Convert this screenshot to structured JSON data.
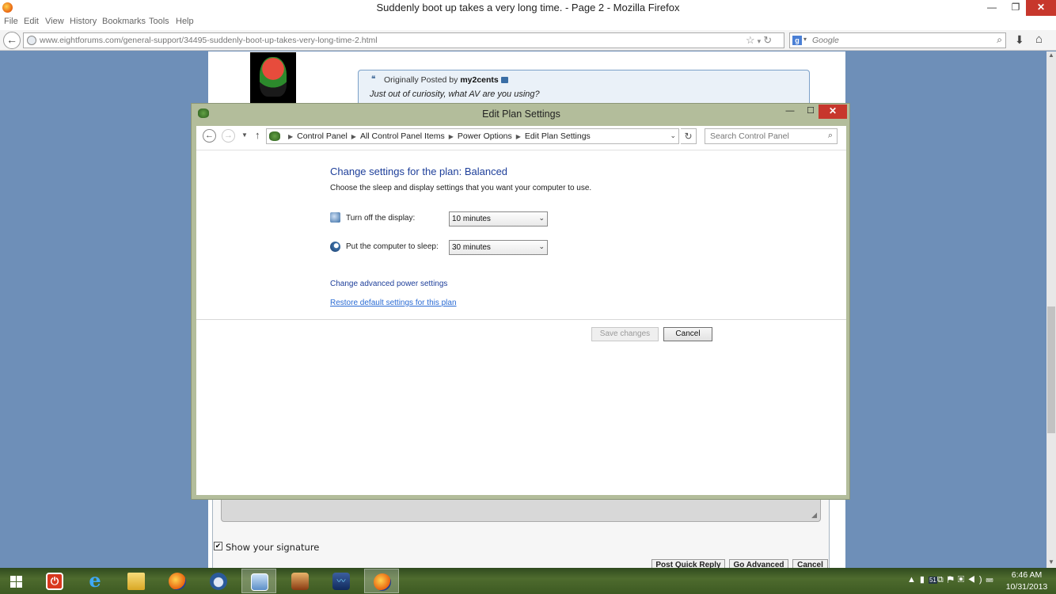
{
  "firefox": {
    "title": "Suddenly boot up takes a very long time. - Page 2 - Mozilla Firefox",
    "menu": [
      "File",
      "Edit",
      "View",
      "History",
      "Bookmarks",
      "Tools",
      "Help"
    ],
    "url": "www.eightforums.com/general-support/34495-suddenly-boot-up-takes-very-long-time-2.html",
    "search_placeholder": "Google"
  },
  "forum": {
    "quote_prefix": "Originally Posted by",
    "quote_author": "my2cents",
    "quote_text": "Just out of curiosity, what AV are you using?",
    "show_signature_label": "Show your signature",
    "buttons": [
      "Post Quick Reply",
      "Go Advanced",
      "Cancel"
    ]
  },
  "dialog": {
    "title": "Edit Plan Settings",
    "breadcrumb": [
      "Control Panel",
      "All Control Panel Items",
      "Power Options",
      "Edit Plan Settings"
    ],
    "search_placeholder": "Search Control Panel",
    "heading": "Change settings for the plan: Balanced",
    "subheading": "Choose the sleep and display settings that you want your computer to use.",
    "display_label": "Turn off the display:",
    "display_value": "10 minutes",
    "sleep_label": "Put the computer to sleep:",
    "sleep_value": "30 minutes",
    "advanced_link": "Change advanced power settings",
    "restore_link": "Restore default settings for this plan",
    "save_button": "Save changes",
    "cancel_button": "Cancel"
  },
  "taskbar": {
    "tray_badge": "51",
    "time": "6:46 AM",
    "date": "10/31/2013"
  },
  "colors": {
    "link_blue": "#1e3f9a",
    "desktop_blue": "#6e8fb8",
    "dialog_frame": "#b3bd9b",
    "close_red": "#c7372c"
  }
}
